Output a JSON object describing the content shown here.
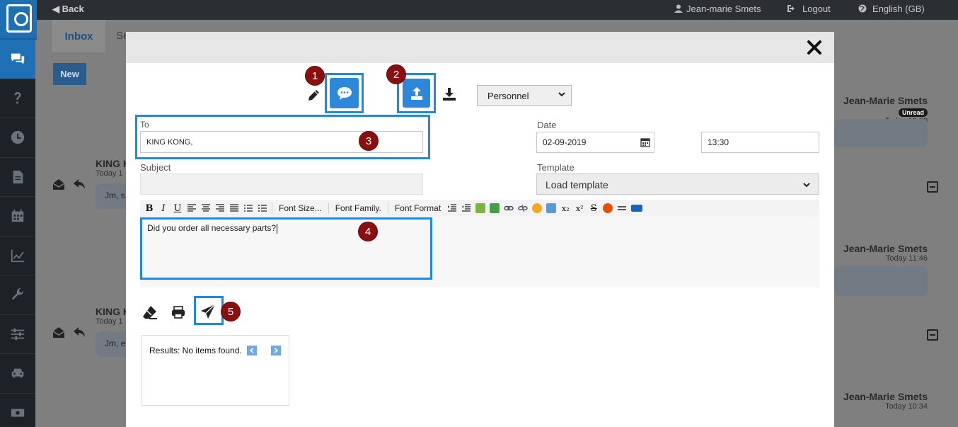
{
  "topbar": {
    "back_label": "◀ Back",
    "user_name": "Jean-marie Smets",
    "logout_label": "Logout",
    "language_label": "English (GB)"
  },
  "tabs": [
    {
      "label": "Inbox",
      "active": true
    },
    {
      "label": "Se",
      "active": false
    }
  ],
  "new_button_label": "New",
  "sidebar": {
    "items": [
      {
        "icon": "chat-icon",
        "active": true
      },
      {
        "icon": "question-icon",
        "active": false
      },
      {
        "icon": "clock-icon",
        "active": false
      },
      {
        "icon": "document-icon",
        "active": false
      },
      {
        "icon": "calendar-icon",
        "active": false
      },
      {
        "icon": "chart-icon",
        "active": false
      },
      {
        "icon": "wrench-icon",
        "active": false
      },
      {
        "icon": "sliders-icon",
        "active": false
      },
      {
        "icon": "car-icon",
        "active": false
      },
      {
        "icon": "money-icon",
        "active": false
      }
    ]
  },
  "background_messages": [
    {
      "name": "KING K",
      "date": "Today 1",
      "preview": "Jm, s"
    },
    {
      "name": "KING K",
      "date": "Today 1",
      "preview": "Jm, e"
    }
  ],
  "background_right_messages": [
    {
      "name": "Jean-Marie Smets",
      "badge": "Unread",
      "date": "Today 13:30"
    },
    {
      "name": "Jean-Marie Smets",
      "date": "Today 11:46"
    },
    {
      "name": "Jean-Marie Smets",
      "date": "Today 10:34"
    }
  ],
  "modal": {
    "department_select": "Personnel",
    "to_label": "To",
    "to_value": "KING KONG,",
    "date_label": "Date",
    "date_value": "02-09-2019",
    "time_value": "13:30",
    "subject_label": "Subject",
    "subject_value": "",
    "template_label": "Template",
    "template_value": "Load template",
    "toolbar": {
      "bold": "B",
      "italic": "I",
      "underline": "U",
      "font_size": "Font Size...",
      "font_family": "Font Family.",
      "font_format": "Font Format",
      "subscript": "x₂",
      "superscript": "x²",
      "strike": "S"
    },
    "body_text": "Did you order all necessary parts?",
    "results_text": "Results: No items found."
  },
  "annotations": [
    "1",
    "2",
    "3",
    "4",
    "5"
  ],
  "colors": {
    "accent": "#1e88e5",
    "badge": "#8b0f0f",
    "sidebar_active": "#1f6fb5"
  }
}
